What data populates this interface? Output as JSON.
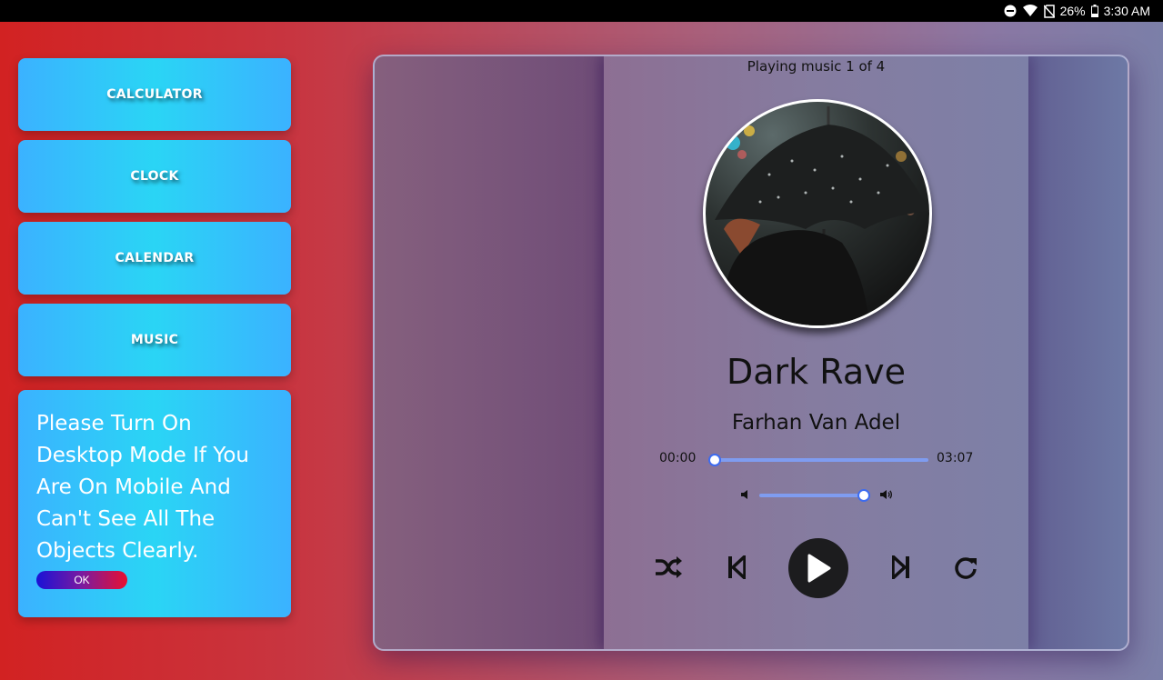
{
  "status_bar": {
    "battery": "26%",
    "time": "3:30 AM",
    "icons": [
      "do-not-disturb-icon",
      "wifi-icon",
      "no-sim-icon",
      "battery-icon"
    ]
  },
  "menu": {
    "calculator": "CALCULATOR",
    "clock": "CLOCK",
    "calendar": "CALENDAR",
    "music": "MUSIC"
  },
  "notice": {
    "text": "Please Turn On Desktop Mode If You Are On Mobile And Can't See All The Objects Clearly.",
    "ok_label": "OK"
  },
  "player": {
    "playing_status": "Playing music 1 of 4",
    "title": "Dark Rave",
    "artist": "Farhan Van Adel",
    "current_time": "00:00",
    "duration": "03:07",
    "progress_fraction": 0.0,
    "volume_fraction": 1.0,
    "controls": [
      "shuffle-icon",
      "previous-icon",
      "play-icon",
      "next-icon",
      "repeat-icon"
    ]
  },
  "colors": {
    "button_gradient": [
      "#3bb2ff",
      "#2ad5f5"
    ],
    "ok_gradient": [
      "#1a12d6",
      "#e81030"
    ],
    "slider_track": "#7f9cf0",
    "slider_thumb_border": "#3d6cf0"
  }
}
